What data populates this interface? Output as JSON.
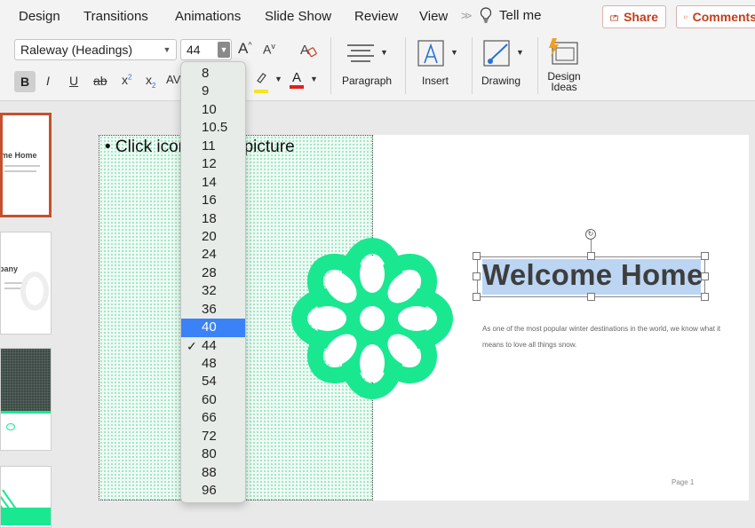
{
  "ribbon_tabs": [
    "Design",
    "Transitions",
    "Animations",
    "Slide Show",
    "Review",
    "View"
  ],
  "more_tabs_icon": "double-chevron-right-icon",
  "tell_me": {
    "icon": "lightbulb-icon",
    "label": "Tell me"
  },
  "share": {
    "icon": "share-icon",
    "label": "Share"
  },
  "comments": {
    "icon": "comment-icon",
    "label": "Comments"
  },
  "font": {
    "name": "Raleway (Headings)",
    "size": "44",
    "bold": "B",
    "italic": "I",
    "underline": "U",
    "strikethrough": "ab",
    "superscript": "x",
    "subscript": "x",
    "grow": "A",
    "shrink": "A",
    "spacing": "AV"
  },
  "groups": {
    "paragraph": "Paragraph",
    "insert": "Insert",
    "drawing": "Drawing",
    "design_ideas": "Design Ideas"
  },
  "font_size_options": [
    "8",
    "9",
    "10",
    "10.5",
    "11",
    "12",
    "14",
    "16",
    "18",
    "20",
    "24",
    "28",
    "32",
    "36",
    "40",
    "44",
    "48",
    "54",
    "60",
    "66",
    "72",
    "80",
    "88",
    "96"
  ],
  "highlighted_option": "40",
  "checked_option": "44",
  "thumbnails": [
    {
      "title": "me Home",
      "selected": true
    },
    {
      "title": "pany",
      "selected": false
    },
    {
      "title": "",
      "selected": false
    },
    {
      "title": "",
      "selected": false
    }
  ],
  "slide": {
    "placeholder_text": "• Click icon to add picture",
    "title": "Welcome Home",
    "description": "As one of the most popular winter destinations in the world, we know what it means to love all things snow.",
    "page_label": "Page 1"
  },
  "colors": {
    "accent": "#c43e1c",
    "mint": "#19e890",
    "highlight": "#f5e425",
    "font_color": "#e0201c",
    "selection": "#3b82f6",
    "title_bg": "#bcd5f3"
  }
}
